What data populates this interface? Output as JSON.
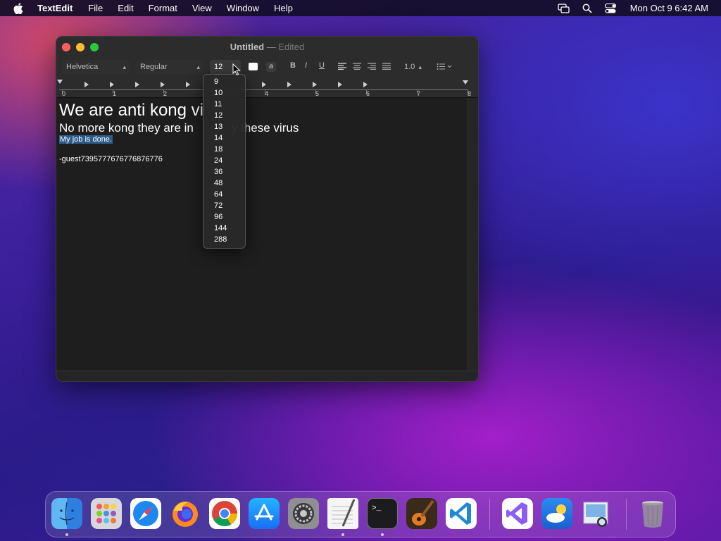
{
  "menubar": {
    "app_name": "TextEdit",
    "items": [
      "File",
      "Edit",
      "Format",
      "View",
      "Window",
      "Help"
    ],
    "clock": "Mon Oct 9  6:42 AM"
  },
  "window": {
    "title": "Untitled",
    "separator": "—",
    "status": "Edited"
  },
  "toolbar": {
    "font_family": "Helvetica",
    "font_style": "Regular",
    "font_size": "12",
    "line_spacing": "1.0",
    "bold": "B",
    "italic": "I",
    "underline": "U"
  },
  "ruler": {
    "numbers": [
      "0",
      "1",
      "2",
      "3",
      "4",
      "5",
      "6",
      "7",
      "8"
    ]
  },
  "document": {
    "line1": "We are anti kong vi",
    "line2": "No more kong they are in",
    "line2_tail": "y these virus",
    "line3": "My job is done.",
    "line4": "-guest7395777676776876776"
  },
  "size_menu": {
    "options": [
      "9",
      "10",
      "11",
      "12",
      "13",
      "14",
      "18",
      "24",
      "36",
      "48",
      "64",
      "72",
      "96",
      "144",
      "288"
    ]
  },
  "dock": {
    "apps": [
      "finder-icon",
      "launchpad-icon",
      "safari-icon",
      "firefox-icon",
      "chrome-icon",
      "app-store-icon",
      "system-settings-icon",
      "textedit-icon",
      "terminal-icon",
      "garageband-icon",
      "vscode-icon",
      "visual-studio-icon",
      "weather-icon",
      "preview-icon",
      "trash-icon"
    ]
  }
}
